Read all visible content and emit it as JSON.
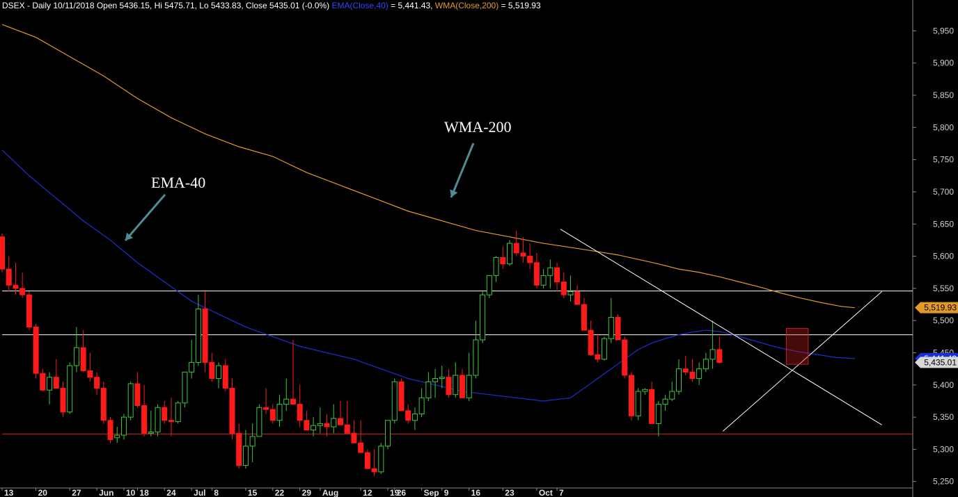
{
  "header": {
    "symbol_info": "DSEX - Daily 10/11/2018 Open 5436.15, Hi 5475.71, Lo 5433.83, Close 5435.01 (-0.0%)",
    "ema_label": "EMA(Close,40)",
    "ema_value": " = 5,441.43,",
    "wma_label": "WMA(Close,200)",
    "wma_value": " = 5,519.93"
  },
  "colors": {
    "background": "#000000",
    "up_candle": "#3ec93e",
    "down_candle": "#ff1a1a",
    "ema": "#1c2fd6",
    "wma": "#e29a26",
    "trendline": "#ffffff",
    "support": "#e02020"
  },
  "chart_data": {
    "type": "candlestick",
    "ylim": [
      5240,
      5985
    ],
    "y_ticks": [
      5250,
      5300,
      5350,
      5400,
      5450,
      5500,
      5550,
      5600,
      5650,
      5700,
      5750,
      5800,
      5850,
      5900,
      5950
    ],
    "y_tick_labels": [
      "5,250",
      "5,300",
      "5,350",
      "5,400",
      "5,450",
      "5,500",
      "5,550",
      "5,600",
      "5,650",
      "5,700",
      "5,750",
      "5,800",
      "5,850",
      "5,900",
      "5,950"
    ],
    "x_ticks": [
      {
        "label": "13",
        "bar": 0
      },
      {
        "label": "20",
        "bar": 5
      },
      {
        "label": "27",
        "bar": 10
      },
      {
        "label": "Jun",
        "bar": 14
      },
      {
        "label": "10",
        "bar": 18
      },
      {
        "label": "18",
        "bar": 20
      },
      {
        "label": "24",
        "bar": 24
      },
      {
        "label": "Jul",
        "bar": 28
      },
      {
        "label": "8",
        "bar": 31
      },
      {
        "label": "15",
        "bar": 36
      },
      {
        "label": "22",
        "bar": 40
      },
      {
        "label": "29",
        "bar": 44
      },
      {
        "label": "Aug",
        "bar": 47
      },
      {
        "label": "12",
        "bar": 53
      },
      {
        "label": "19",
        "bar": 57
      },
      {
        "label": "26",
        "bar": 58
      },
      {
        "label": "Sep",
        "bar": 62
      },
      {
        "label": "9",
        "bar": 65
      },
      {
        "label": "16",
        "bar": 69
      },
      {
        "label": "23",
        "bar": 74
      },
      {
        "label": "Oct",
        "bar": 79
      },
      {
        "label": "7",
        "bar": 82
      }
    ],
    "candles": [
      [
        5630,
        5635,
        5575,
        5580
      ],
      [
        5580,
        5600,
        5545,
        5555
      ],
      [
        5555,
        5590,
        5540,
        5550
      ],
      [
        5550,
        5575,
        5535,
        5540
      ],
      [
        5540,
        5545,
        5485,
        5490
      ],
      [
        5490,
        5495,
        5410,
        5418
      ],
      [
        5418,
        5425,
        5390,
        5392
      ],
      [
        5392,
        5420,
        5370,
        5412
      ],
      [
        5412,
        5440,
        5395,
        5395
      ],
      [
        5395,
        5405,
        5350,
        5358
      ],
      [
        5358,
        5435,
        5355,
        5430
      ],
      [
        5430,
        5490,
        5420,
        5458
      ],
      [
        5458,
        5485,
        5420,
        5422
      ],
      [
        5422,
        5450,
        5405,
        5412
      ],
      [
        5412,
        5420,
        5385,
        5395
      ],
      [
        5395,
        5405,
        5340,
        5345
      ],
      [
        5345,
        5350,
        5310,
        5315
      ],
      [
        5318,
        5335,
        5310,
        5322
      ],
      [
        5322,
        5355,
        5315,
        5350
      ],
      [
        5350,
        5405,
        5345,
        5402
      ],
      [
        5402,
        5420,
        5365,
        5368
      ],
      [
        5368,
        5400,
        5320,
        5325
      ],
      [
        5325,
        5360,
        5320,
        5327
      ],
      [
        5327,
        5370,
        5320,
        5365
      ],
      [
        5365,
        5375,
        5340,
        5345
      ],
      [
        5345,
        5380,
        5320,
        5343
      ],
      [
        5343,
        5375,
        5340,
        5372
      ],
      [
        5372,
        5420,
        5365,
        5420
      ],
      [
        5420,
        5470,
        5410,
        5435
      ],
      [
        5435,
        5540,
        5430,
        5518
      ],
      [
        5518,
        5545,
        5420,
        5435
      ],
      [
        5435,
        5450,
        5405,
        5410
      ],
      [
        5410,
        5435,
        5395,
        5430
      ],
      [
        5430,
        5440,
        5390,
        5395
      ],
      [
        5395,
        5410,
        5315,
        5325
      ],
      [
        5325,
        5340,
        5270,
        5275
      ],
      [
        5275,
        5330,
        5270,
        5305
      ],
      [
        5305,
        5340,
        5280,
        5320
      ],
      [
        5320,
        5370,
        5320,
        5365
      ],
      [
        5365,
        5395,
        5355,
        5362
      ],
      [
        5362,
        5370,
        5340,
        5345
      ],
      [
        5345,
        5385,
        5335,
        5370
      ],
      [
        5370,
        5410,
        5360,
        5378
      ],
      [
        5378,
        5470,
        5370,
        5370
      ],
      [
        5370,
        5400,
        5335,
        5345
      ],
      [
        5345,
        5360,
        5330,
        5330
      ],
      [
        5330,
        5350,
        5320,
        5337
      ],
      [
        5337,
        5365,
        5325,
        5340
      ],
      [
        5340,
        5355,
        5320,
        5335
      ],
      [
        5335,
        5370,
        5325,
        5348
      ],
      [
        5348,
        5375,
        5340,
        5338
      ],
      [
        5338,
        5375,
        5330,
        5325
      ],
      [
        5325,
        5345,
        5310,
        5310
      ],
      [
        5310,
        5345,
        5295,
        5295
      ],
      [
        5295,
        5300,
        5270,
        5270
      ],
      [
        5270,
        5300,
        5258,
        5265
      ],
      [
        5265,
        5310,
        5262,
        5305
      ],
      [
        5305,
        5330,
        5300,
        5345
      ],
      [
        5345,
        5410,
        5340,
        5405
      ],
      [
        5405,
        5410,
        5360,
        5360
      ],
      [
        5360,
        5370,
        5340,
        5345
      ],
      [
        5345,
        5365,
        5330,
        5355
      ],
      [
        5355,
        5395,
        5350,
        5380
      ],
      [
        5380,
        5420,
        5375,
        5405
      ],
      [
        5405,
        5425,
        5380,
        5410
      ],
      [
        5410,
        5430,
        5395,
        5412
      ],
      [
        5412,
        5425,
        5380,
        5385
      ],
      [
        5385,
        5435,
        5380,
        5415
      ],
      [
        5415,
        5425,
        5410,
        5380
      ],
      [
        5380,
        5450,
        5375,
        5415
      ],
      [
        5415,
        5500,
        5410,
        5470
      ],
      [
        5470,
        5545,
        5465,
        5540
      ],
      [
        5540,
        5570,
        5535,
        5570
      ],
      [
        5570,
        5600,
        5560,
        5598
      ],
      [
        5598,
        5615,
        5580,
        5588
      ],
      [
        5588,
        5625,
        5585,
        5620
      ],
      [
        5620,
        5640,
        5600,
        5605
      ],
      [
        5605,
        5630,
        5590,
        5600
      ],
      [
        5600,
        5620,
        5580,
        5590
      ],
      [
        5590,
        5605,
        5550,
        5555
      ],
      [
        5555,
        5580,
        5550,
        5570
      ],
      [
        5570,
        5595,
        5550,
        5582
      ],
      [
        5582,
        5590,
        5545,
        5560
      ],
      [
        5560,
        5575,
        5535,
        5540
      ],
      [
        5540,
        5570,
        5530,
        5545
      ],
      [
        5545,
        5555,
        5525,
        5525
      ],
      [
        5525,
        5535,
        5485,
        5485
      ],
      [
        5485,
        5500,
        5445,
        5447
      ],
      [
        5447,
        5480,
        5435,
        5440
      ],
      [
        5440,
        5475,
        5438,
        5472
      ],
      [
        5472,
        5535,
        5465,
        5505
      ],
      [
        5505,
        5510,
        5470,
        5470
      ],
      [
        5470,
        5475,
        5410,
        5415
      ],
      [
        5415,
        5420,
        5345,
        5352
      ],
      [
        5352,
        5395,
        5345,
        5390
      ],
      [
        5390,
        5395,
        5385,
        5393
      ],
      [
        5393,
        5405,
        5340,
        5340
      ],
      [
        5340,
        5375,
        5320,
        5370
      ],
      [
        5370,
        5385,
        5360,
        5378
      ],
      [
        5378,
        5405,
        5375,
        5390
      ],
      [
        5390,
        5440,
        5385,
        5425
      ],
      [
        5425,
        5445,
        5415,
        5420
      ],
      [
        5420,
        5440,
        5405,
        5410
      ],
      [
        5410,
        5435,
        5400,
        5425
      ],
      [
        5425,
        5450,
        5420,
        5440
      ],
      [
        5440,
        5500,
        5425,
        5455
      ],
      [
        5455,
        5475,
        5433,
        5435
      ]
    ],
    "ema40": [
      [
        0,
        5765
      ],
      [
        4,
        5725
      ],
      [
        8,
        5690
      ],
      [
        12,
        5655
      ],
      [
        16,
        5625
      ],
      [
        20,
        5590
      ],
      [
        24,
        5560
      ],
      [
        28,
        5530
      ],
      [
        32,
        5510
      ],
      [
        36,
        5490
      ],
      [
        40,
        5475
      ],
      [
        44,
        5460
      ],
      [
        48,
        5450
      ],
      [
        52,
        5440
      ],
      [
        56,
        5425
      ],
      [
        60,
        5410
      ],
      [
        64,
        5400
      ],
      [
        68,
        5390
      ],
      [
        72,
        5385
      ],
      [
        76,
        5380
      ],
      [
        80,
        5375
      ],
      [
        84,
        5380
      ],
      [
        86,
        5395
      ],
      [
        88,
        5410
      ],
      [
        90,
        5425
      ],
      [
        92,
        5440
      ],
      [
        94,
        5455
      ],
      [
        96,
        5465
      ],
      [
        98,
        5472
      ],
      [
        100,
        5478
      ],
      [
        102,
        5482
      ],
      [
        104,
        5485
      ],
      [
        106,
        5483
      ],
      [
        108,
        5478
      ],
      [
        110,
        5472
      ],
      [
        112,
        5466
      ],
      [
        114,
        5460
      ],
      [
        116,
        5455
      ],
      [
        118,
        5451
      ],
      [
        120,
        5448
      ],
      [
        123,
        5443
      ],
      [
        126,
        5441
      ]
    ],
    "wma200": [
      [
        0,
        5960
      ],
      [
        5,
        5940
      ],
      [
        10,
        5910
      ],
      [
        15,
        5880
      ],
      [
        20,
        5845
      ],
      [
        25,
        5815
      ],
      [
        30,
        5790
      ],
      [
        35,
        5770
      ],
      [
        40,
        5755
      ],
      [
        45,
        5730
      ],
      [
        50,
        5710
      ],
      [
        55,
        5690
      ],
      [
        60,
        5670
      ],
      [
        65,
        5655
      ],
      [
        70,
        5640
      ],
      [
        75,
        5630
      ],
      [
        80,
        5620
      ],
      [
        85,
        5612
      ],
      [
        88,
        5607
      ],
      [
        91,
        5602
      ],
      [
        94,
        5595
      ],
      [
        97,
        5588
      ],
      [
        100,
        5580
      ],
      [
        103,
        5575
      ],
      [
        106,
        5568
      ],
      [
        109,
        5560
      ],
      [
        112,
        5552
      ],
      [
        115,
        5543
      ],
      [
        118,
        5535
      ],
      [
        121,
        5528
      ],
      [
        124,
        5522
      ],
      [
        126,
        5520
      ]
    ],
    "horizontal_lines": [
      {
        "value": 5546,
        "color": "#ffffff"
      },
      {
        "value": 5478,
        "color": "#ffffff"
      },
      {
        "value": 5324,
        "color": "#e02020"
      }
    ],
    "trend_lines": [
      {
        "from": [
          82.5,
          5642
        ],
        "to": [
          130,
          5338
        ]
      },
      {
        "from": [
          106.5,
          5328
        ],
        "to": [
          130,
          5545
        ]
      }
    ],
    "highlight_box": {
      "from": [
        116.4,
        5488
      ],
      "to": [
        118.6,
        5432
      ]
    },
    "annotations": [
      {
        "text": "EMA-40",
        "x": 18,
        "y": 5722
      },
      {
        "text": "WMA-200",
        "x": 63,
        "y": 5811
      }
    ],
    "last_values": [
      {
        "label": "5,519.93",
        "value": 5520,
        "color": "#e29a26",
        "text_color": "#000000"
      },
      {
        "label": "5,441.43",
        "value": 5441,
        "color": "#1c2fd6",
        "text_color": "#ffffff"
      },
      {
        "label": "5,435.01",
        "value": 5435,
        "color": "#d8d8d8",
        "text_color": "#000000"
      }
    ]
  }
}
